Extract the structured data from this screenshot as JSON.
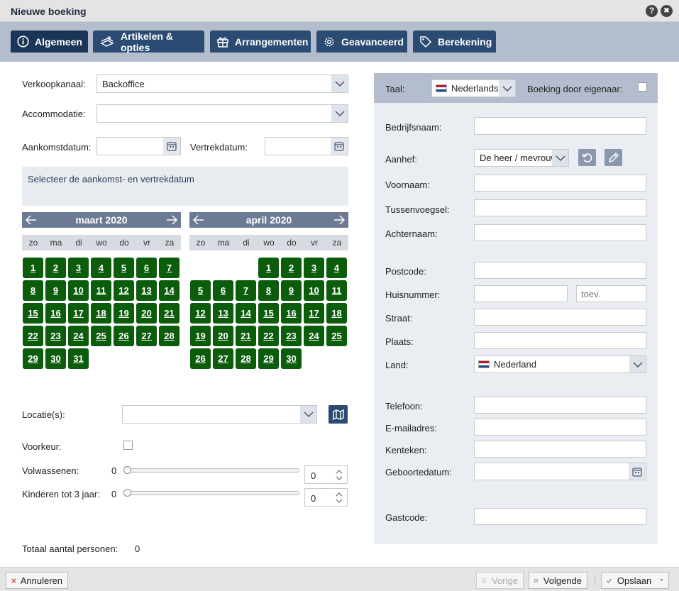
{
  "window": {
    "title": "Nieuwe boeking",
    "help_icon": "?",
    "close_icon": "✖"
  },
  "tabs": [
    {
      "label": "Algemeen",
      "icon": "info-icon"
    },
    {
      "label": "Artikelen & opties",
      "icon": "items-icon"
    },
    {
      "label": "Arrangementen",
      "icon": "gift-icon"
    },
    {
      "label": "Geavanceerd",
      "icon": "gear-icon"
    },
    {
      "label": "Berekening",
      "icon": "tag-icon"
    }
  ],
  "left": {
    "verkoopkanaal_label": "Verkoopkanaal:",
    "verkoopkanaal_value": "Backoffice",
    "accommodatie_label": "Accommodatie:",
    "accommodatie_value": "",
    "aankomst_label": "Aankomstdatum:",
    "vertrek_label": "Vertrekdatum:",
    "info_text": "Selecteer de aankomst- en vertrekdatum",
    "calendars": [
      {
        "month": "maart 2020",
        "days": [
          "1",
          "2",
          "3",
          "4",
          "5",
          "6",
          "7",
          "8",
          "9",
          "10",
          "11",
          "12",
          "13",
          "14",
          "15",
          "16",
          "17",
          "18",
          "19",
          "20",
          "21",
          "22",
          "23",
          "24",
          "25",
          "26",
          "27",
          "28",
          "29",
          "30",
          "31"
        ],
        "first_weekday": 0
      },
      {
        "month": "april 2020",
        "days": [
          "1",
          "2",
          "3",
          "4",
          "5",
          "6",
          "7",
          "8",
          "9",
          "10",
          "11",
          "12",
          "13",
          "14",
          "15",
          "16",
          "17",
          "18",
          "19",
          "20",
          "21",
          "22",
          "23",
          "24",
          "25",
          "26",
          "27",
          "28",
          "29",
          "30"
        ],
        "first_weekday": 3
      }
    ],
    "weekdays": [
      "zo",
      "ma",
      "di",
      "wo",
      "do",
      "vr",
      "za"
    ],
    "locatie_label": "Locatie(s):",
    "locatie_value": "",
    "voorkeur_label": "Voorkeur:",
    "volwassenen_label": "Volwassenen:",
    "volwassenen_min": "0",
    "volwassenen_value": "0",
    "kinderen_label": "Kinderen tot 3 jaar:",
    "kinderen_min": "0",
    "kinderen_value": "0",
    "totaal_label": "Totaal aantal personen:",
    "totaal_value": "0"
  },
  "right": {
    "taal_label": "Taal:",
    "taal_value": "Nederlands",
    "eigenaar_label": "Boeking door eigenaar:",
    "bedrijfsnaam_label": "Bedrijfsnaam:",
    "aanhef_label": "Aanhef:",
    "aanhef_value": "De heer / mevrouw",
    "voornaam_label": "Voornaam:",
    "tussenvoegsel_label": "Tussenvoegsel:",
    "achternaam_label": "Achternaam:",
    "postcode_label": "Postcode:",
    "huisnummer_label": "Huisnummer:",
    "toev_placeholder": "toev.",
    "straat_label": "Straat:",
    "plaats_label": "Plaats:",
    "land_label": "Land:",
    "land_value": "Nederland",
    "telefoon_label": "Telefoon:",
    "email_label": "E-mailadres:",
    "kenteken_label": "Kenteken:",
    "geboortedatum_label": "Geboortedatum:",
    "gastcode_label": "Gastcode:"
  },
  "footer": {
    "annuleren": "Annuleren",
    "vorige": "Vorige",
    "volgende": "Volgende",
    "opslaan": "Opslaan"
  },
  "colors": {
    "tab_bg": "#2b4b72",
    "tab_active": "#1a3557",
    "day_green": "#0b5c0b",
    "panel_bg": "#eaedf2",
    "header_bar": "#b4bdce"
  }
}
